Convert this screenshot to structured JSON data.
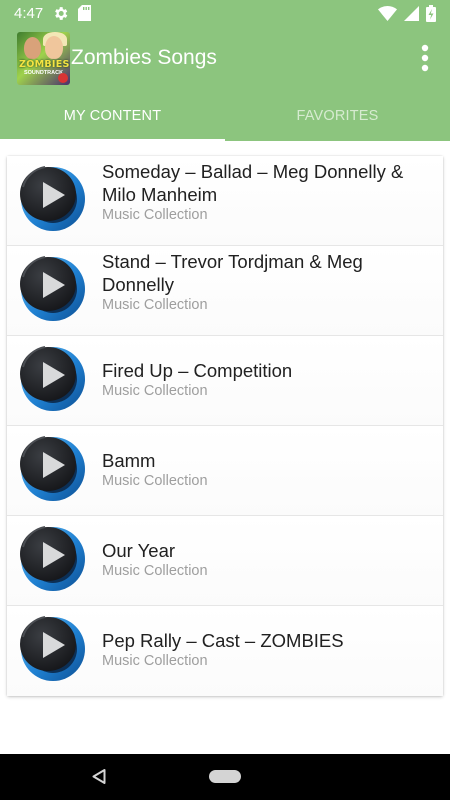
{
  "status_bar": {
    "time": "4:47",
    "icons": [
      "settings-icon",
      "sd-card-icon",
      "wifi-icon",
      "signal-icon",
      "battery-charging-icon"
    ]
  },
  "app_bar": {
    "title": "Zombies Songs",
    "logo_text": "ZOMBIES",
    "logo_subtext": "SOUNDTRACK",
    "menu_icon": "more-vertical-icon"
  },
  "tabs": [
    {
      "label": "MY CONTENT",
      "active": true
    },
    {
      "label": "FAVORITES",
      "active": false
    }
  ],
  "songs": [
    {
      "title": "Someday – Ballad – Meg Donnelly & Milo Manheim",
      "subtitle": "Music Collection"
    },
    {
      "title": "Stand – Trevor Tordjman & Meg Donnelly",
      "subtitle": "Music Collection"
    },
    {
      "title": "Fired Up – Competition",
      "subtitle": "Music Collection"
    },
    {
      "title": "Bamm",
      "subtitle": "Music Collection"
    },
    {
      "title": "Our Year",
      "subtitle": "Music Collection"
    },
    {
      "title": "Pep Rally – Cast – ZOMBIES",
      "subtitle": "Music Collection"
    }
  ],
  "nav_bar": {
    "icons": [
      "back-icon",
      "home-pill-icon"
    ]
  },
  "colors": {
    "primary": "#8cc57e",
    "tab_inactive_text": "#d6ebd0",
    "play_ring": "#2d8fd8",
    "play_disc": "#1d1f22"
  }
}
